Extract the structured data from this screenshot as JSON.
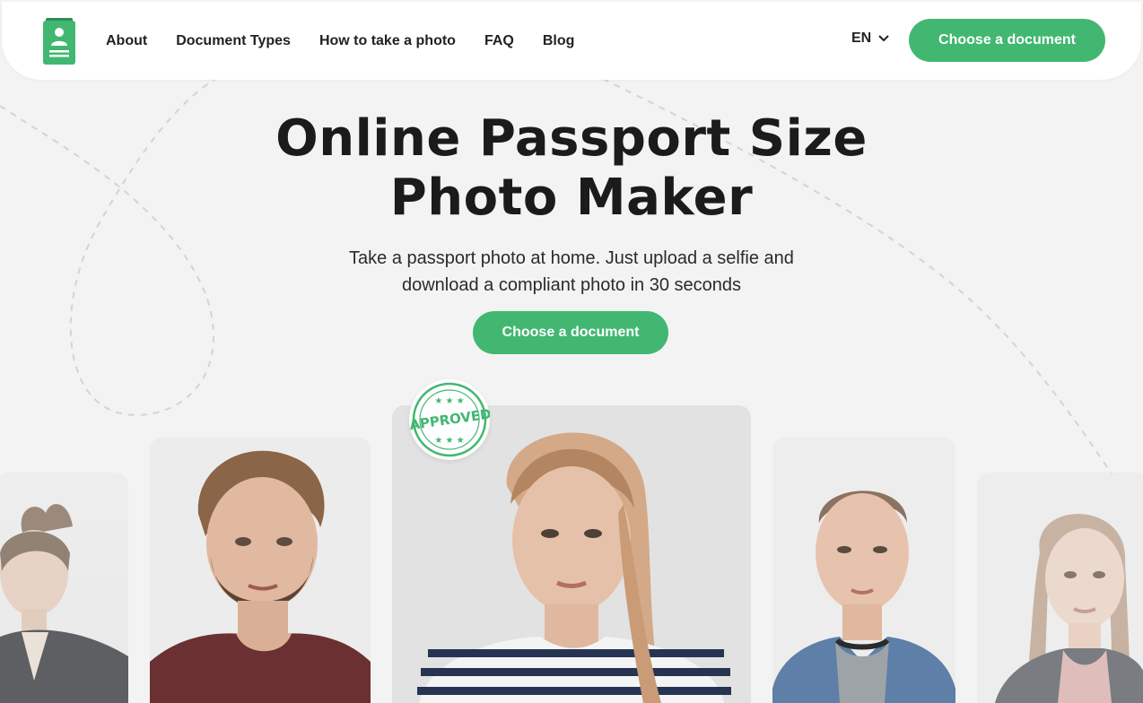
{
  "nav": {
    "links": [
      "About",
      "Document Types",
      "How to take a photo",
      "FAQ",
      "Blog"
    ],
    "lang": "EN",
    "cta": "Choose a document"
  },
  "hero": {
    "title_line1": "Online Passport Size",
    "title_line2": "Photo Maker",
    "subtitle_line1": "Take a passport photo at home. Just upload a selfie and",
    "subtitle_line2": "download a compliant photo in 30 seconds",
    "cta": "Choose a document"
  },
  "stamp": {
    "text": "APPROVED"
  },
  "icons": {
    "logo": "id-card-icon",
    "lang_chevron": "chevron-down-icon"
  },
  "colors": {
    "accent": "#42b771",
    "background": "#f2f3f2",
    "text": "#1c1c1c"
  }
}
